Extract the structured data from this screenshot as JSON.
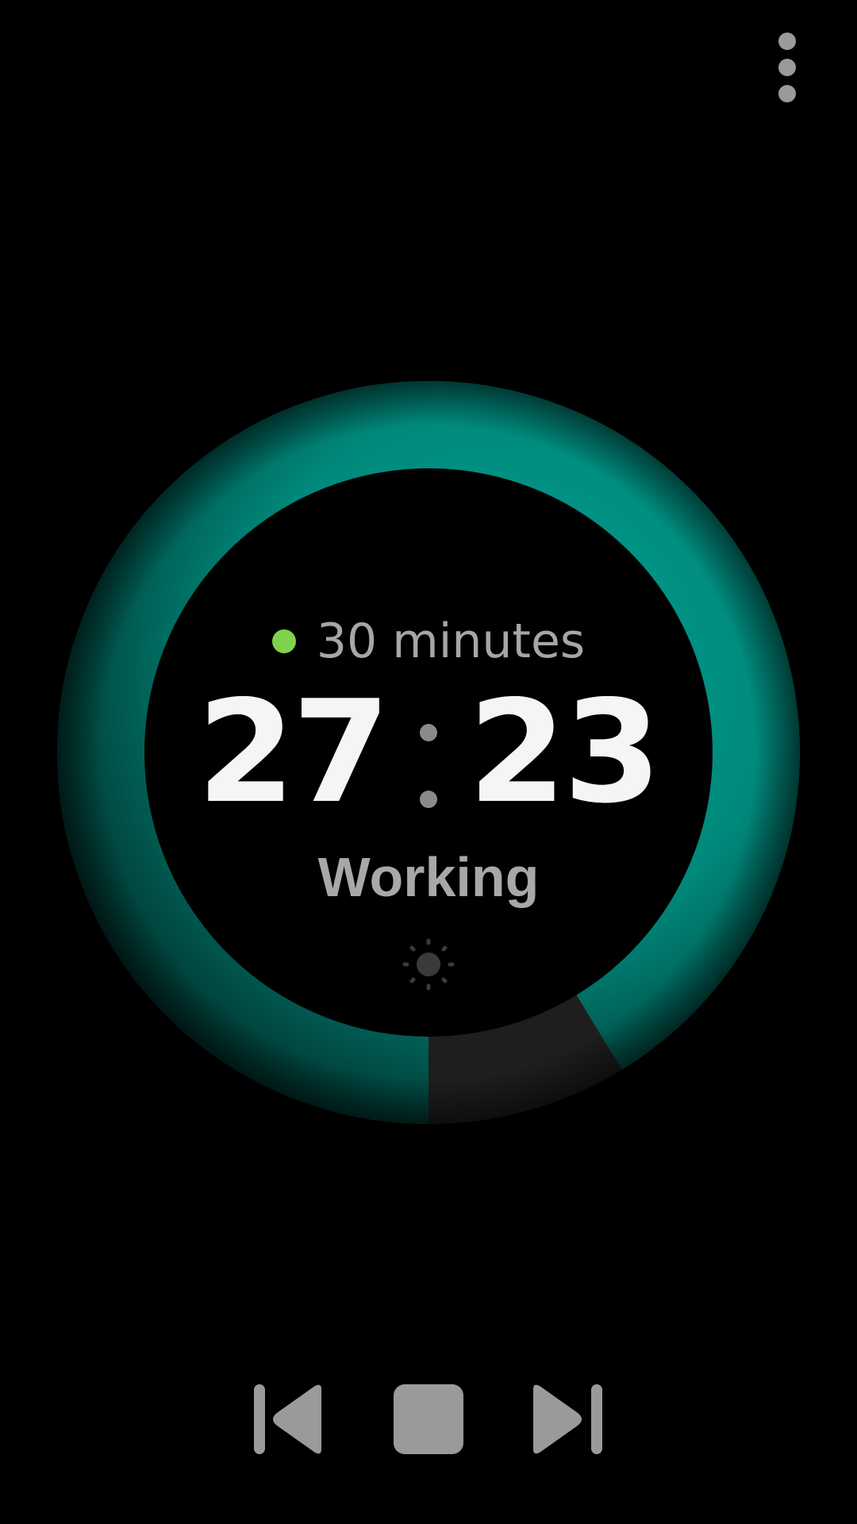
{
  "app": {
    "status_color": "#7ed34b",
    "accent_color": "#00897b",
    "track_color": "#1e1e1e",
    "text_color": "#f5f5f5",
    "muted_color": "#a6a6a6"
  },
  "header": {
    "menu_icon": "more-vert-icon"
  },
  "timer": {
    "duration_label": "30 minutes",
    "minutes": "27",
    "seconds": "23",
    "state": "Working",
    "remaining_fraction": 0.9128
  },
  "brightness": {
    "icon": "brightness-icon"
  },
  "controls": {
    "previous_icon": "skip-previous-icon",
    "stop_icon": "stop-icon",
    "next_icon": "skip-next-icon"
  }
}
